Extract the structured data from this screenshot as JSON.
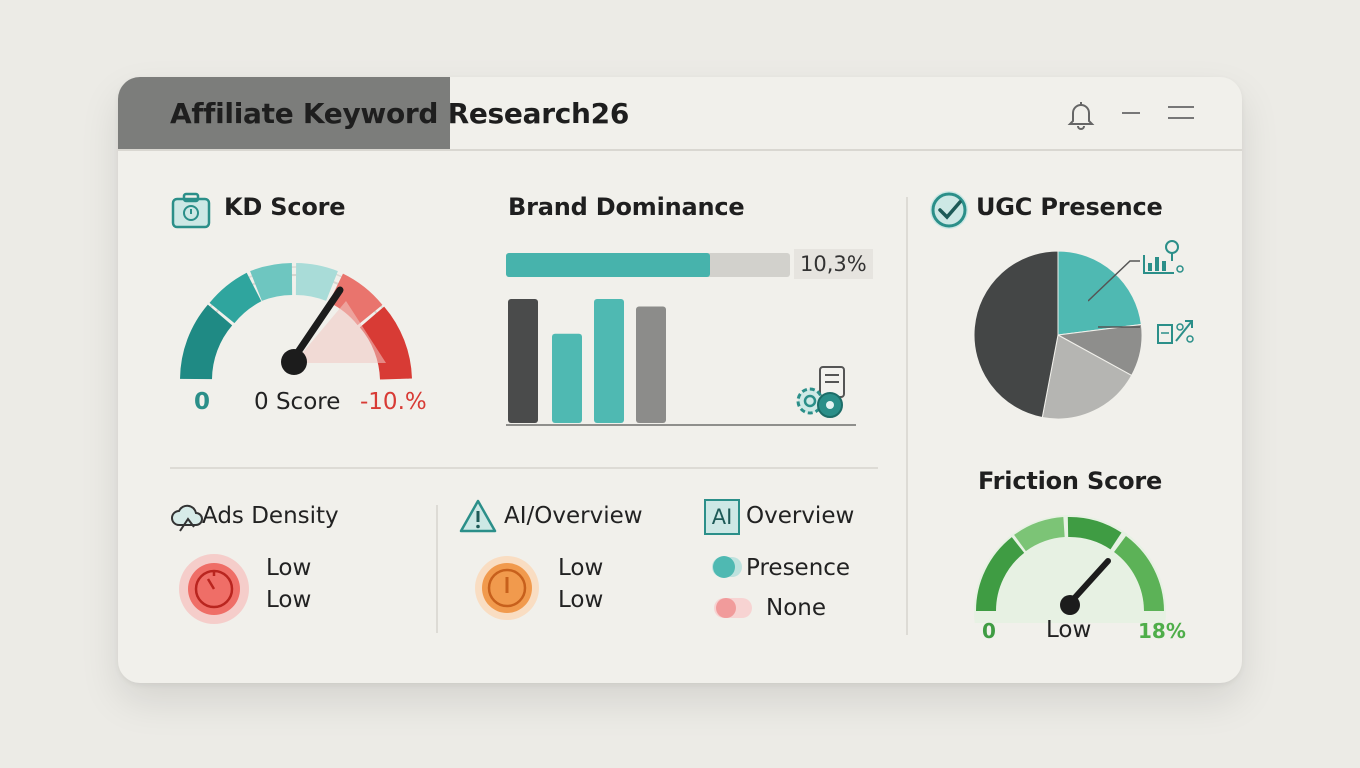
{
  "window": {
    "title": "Affiliate Keyword Research26",
    "controls": [
      "bell-icon",
      "minimize-icon",
      "menu-icon"
    ]
  },
  "kd_score": {
    "title": "KD Score",
    "icon": "briefcase-icon",
    "min_label": "0",
    "center_label": "0 Score",
    "max_label": "-10.%",
    "needle_value": 0.72
  },
  "brand_dominance": {
    "title": "Brand Dominance",
    "progress_label": "10,3%",
    "progress_fraction": 0.72,
    "bars": [
      {
        "value": 1.0,
        "color": "#4a4b4b"
      },
      {
        "value": 0.72,
        "color": "#4fb9b2"
      },
      {
        "value": 1.0,
        "color": "#4fb9b2"
      },
      {
        "value": 0.94,
        "color": "#8c8c8a"
      }
    ],
    "icon": "settings-gear-icon"
  },
  "ugc_presence": {
    "title": "UGC Presence",
    "icon": "check-circle-icon",
    "slices": [
      {
        "value": 0.23,
        "color": "#4fb9b2"
      },
      {
        "value": 0.1,
        "color": "#8e8e8c"
      },
      {
        "value": 0.2,
        "color": "#b5b5b2"
      },
      {
        "value": 0.47,
        "color": "#444646"
      }
    ],
    "callout_icons": [
      "analytics-icon",
      "growth-icon"
    ]
  },
  "friction_score": {
    "title": "Friction Score",
    "min_label": "0",
    "center_label": "Low",
    "max_label": "18%",
    "needle_value": 0.78
  },
  "ads_density": {
    "title": "Ads Density",
    "icon": "cloud-icon",
    "values": [
      "Low",
      "Low"
    ],
    "status_color": "#e35b55"
  },
  "ai_overview_alert": {
    "title": "AI/Overview",
    "icon": "warning-icon",
    "values": [
      "Low",
      "Low"
    ],
    "status_color": "#ef8a3a"
  },
  "ai_overview": {
    "badge": "AI",
    "title": "Overview",
    "options": [
      {
        "label": "Presence",
        "color": "#4fb9b2"
      },
      {
        "label": "None",
        "color": "#f19b9b"
      }
    ]
  }
}
